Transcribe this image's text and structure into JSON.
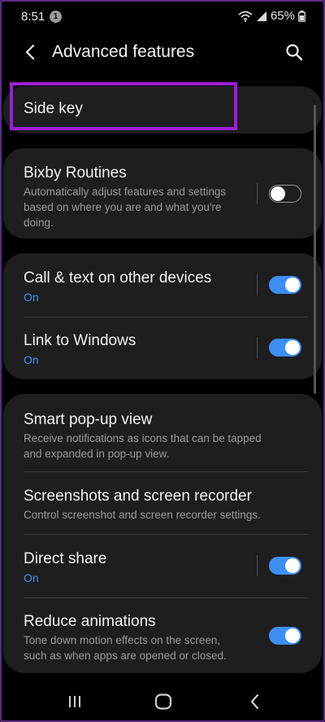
{
  "status_bar": {
    "time": "8:51",
    "notification_count": "1",
    "battery": "65%"
  },
  "header": {
    "title": "Advanced features"
  },
  "items": {
    "side_key": {
      "title": "Side key"
    },
    "bixby": {
      "title": "Bixby Routines",
      "desc_line1": "Automatically adjust features and settings",
      "desc_line2": "based on where you are and what you're",
      "desc_line3": "doing.",
      "toggle": false
    },
    "call_text": {
      "title": "Call & text on other devices",
      "status": "On",
      "toggle": true
    },
    "link_windows": {
      "title": "Link to Windows",
      "status": "On",
      "toggle": true
    },
    "smart_popup": {
      "title": "Smart pop-up view",
      "desc_line1": "Receive notifications as icons that can be tapped",
      "desc_line2": "and expanded in pop-up view."
    },
    "screenshots": {
      "title": "Screenshots and screen recorder",
      "desc_line1": "Control screenshot and screen recorder settings."
    },
    "direct_share": {
      "title": "Direct share",
      "status": "On",
      "toggle": true
    },
    "reduce_anim": {
      "title": "Reduce animations",
      "desc_line1": "Tone down motion effects on the screen,",
      "desc_line2": "such as when apps are opened or closed.",
      "toggle": true
    }
  },
  "icons": {
    "back": "chevron-left-icon",
    "search": "search-icon",
    "wifi": "wifi-icon",
    "signal": "signal-icon",
    "battery": "battery-icon",
    "recents": "recents-icon",
    "home": "home-icon",
    "nav_back": "nav-back-icon"
  },
  "colors": {
    "accent": "#3e8ef4",
    "highlight": "#9d1fd6",
    "card": "#1e1e1e"
  }
}
